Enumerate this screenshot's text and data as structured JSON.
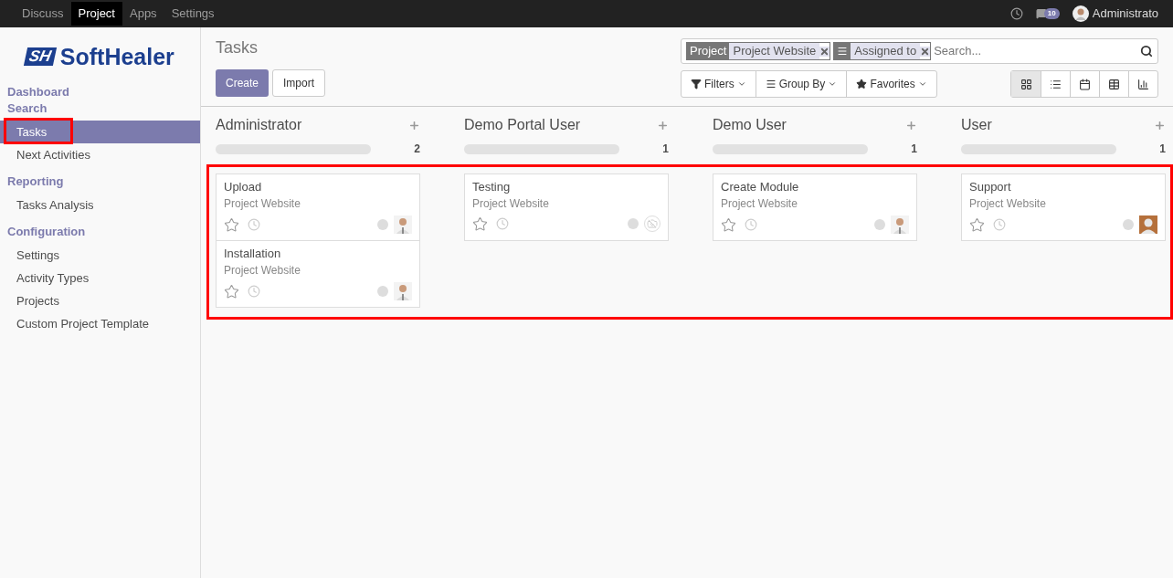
{
  "topbar": {
    "menu": [
      {
        "label": "Discuss",
        "selected": false
      },
      {
        "label": "Project",
        "selected": true
      },
      {
        "label": "Apps",
        "selected": false
      },
      {
        "label": "Settings",
        "selected": false
      }
    ],
    "messages_count": "10",
    "user": "Administrato"
  },
  "sidebar": {
    "logo": {
      "mark": "SH",
      "name": "SoftHealer"
    },
    "sections": [
      {
        "title": "Dashboard"
      },
      {
        "title": "Search",
        "items": [
          {
            "label": "Tasks",
            "selected": true,
            "highlighted": true
          },
          {
            "label": "Next Activities",
            "selected": false,
            "highlighted": false
          }
        ]
      },
      {
        "title": "Reporting",
        "items": [
          {
            "label": "Tasks Analysis",
            "selected": false,
            "highlighted": false
          }
        ]
      },
      {
        "title": "Configuration",
        "items": [
          {
            "label": "Settings",
            "selected": false,
            "highlighted": false
          },
          {
            "label": "Activity Types",
            "selected": false,
            "highlighted": false
          },
          {
            "label": "Projects",
            "selected": false,
            "highlighted": false
          },
          {
            "label": "Custom Project Template",
            "selected": false,
            "highlighted": false
          }
        ]
      }
    ]
  },
  "breadcrumb": "Tasks",
  "buttons": [
    {
      "label": "Create",
      "kind": "primary"
    },
    {
      "label": "Import",
      "kind": "secondary"
    }
  ],
  "search": {
    "facets": [
      {
        "kind": "label",
        "label": "Project",
        "value": "Project Website"
      },
      {
        "kind": "groupby",
        "value": "Assigned to"
      }
    ],
    "placeholder": "Search..."
  },
  "filter_buttons": [
    {
      "kind": "filter",
      "label": "Filters"
    },
    {
      "kind": "groupby",
      "label": "Group By"
    },
    {
      "kind": "star",
      "label": "Favorites"
    }
  ],
  "views": [
    {
      "kind": "kanban",
      "selected": true
    },
    {
      "kind": "list",
      "selected": false
    },
    {
      "kind": "calendar",
      "selected": false
    },
    {
      "kind": "pivot",
      "selected": false
    },
    {
      "kind": "graph",
      "selected": false
    }
  ],
  "kanban_highlighted": true,
  "columns": [
    {
      "title": "Administrator",
      "count": "2",
      "cards": [
        {
          "title": "Upload",
          "project": "Project Website"
        },
        {
          "title": "Installation",
          "project": "Project Website"
        }
      ]
    },
    {
      "title": "Demo Portal User",
      "count": "1",
      "cards": [
        {
          "title": "Testing",
          "project": "Project Website",
          "avatar": {
            "kind": "none"
          }
        }
      ]
    },
    {
      "title": "Demo User",
      "count": "1",
      "cards": [
        {
          "title": "Create Module",
          "project": "Project Website"
        }
      ]
    },
    {
      "title": "User",
      "count": "1",
      "cards": [
        {
          "title": "Support",
          "project": "Project Website",
          "avatar": {
            "kind": "default"
          }
        }
      ]
    }
  ]
}
